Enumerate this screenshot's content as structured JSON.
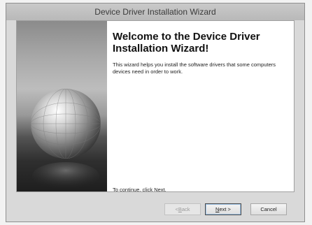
{
  "window": {
    "title": "Device Driver Installation Wizard"
  },
  "content": {
    "heading": "Welcome to the Device Driver\nInstallation Wizard!",
    "description": "This wizard helps you install the software drivers that some computers devices need in order to work.",
    "continue_text": "To continue, click Next."
  },
  "buttons": {
    "back": {
      "prefix": "< ",
      "mnemonic": "B",
      "rest": "ack",
      "enabled": false
    },
    "next": {
      "prefix": "",
      "mnemonic": "N",
      "rest": "ext >",
      "enabled": true
    },
    "cancel": {
      "label": "Cancel",
      "enabled": true
    }
  }
}
